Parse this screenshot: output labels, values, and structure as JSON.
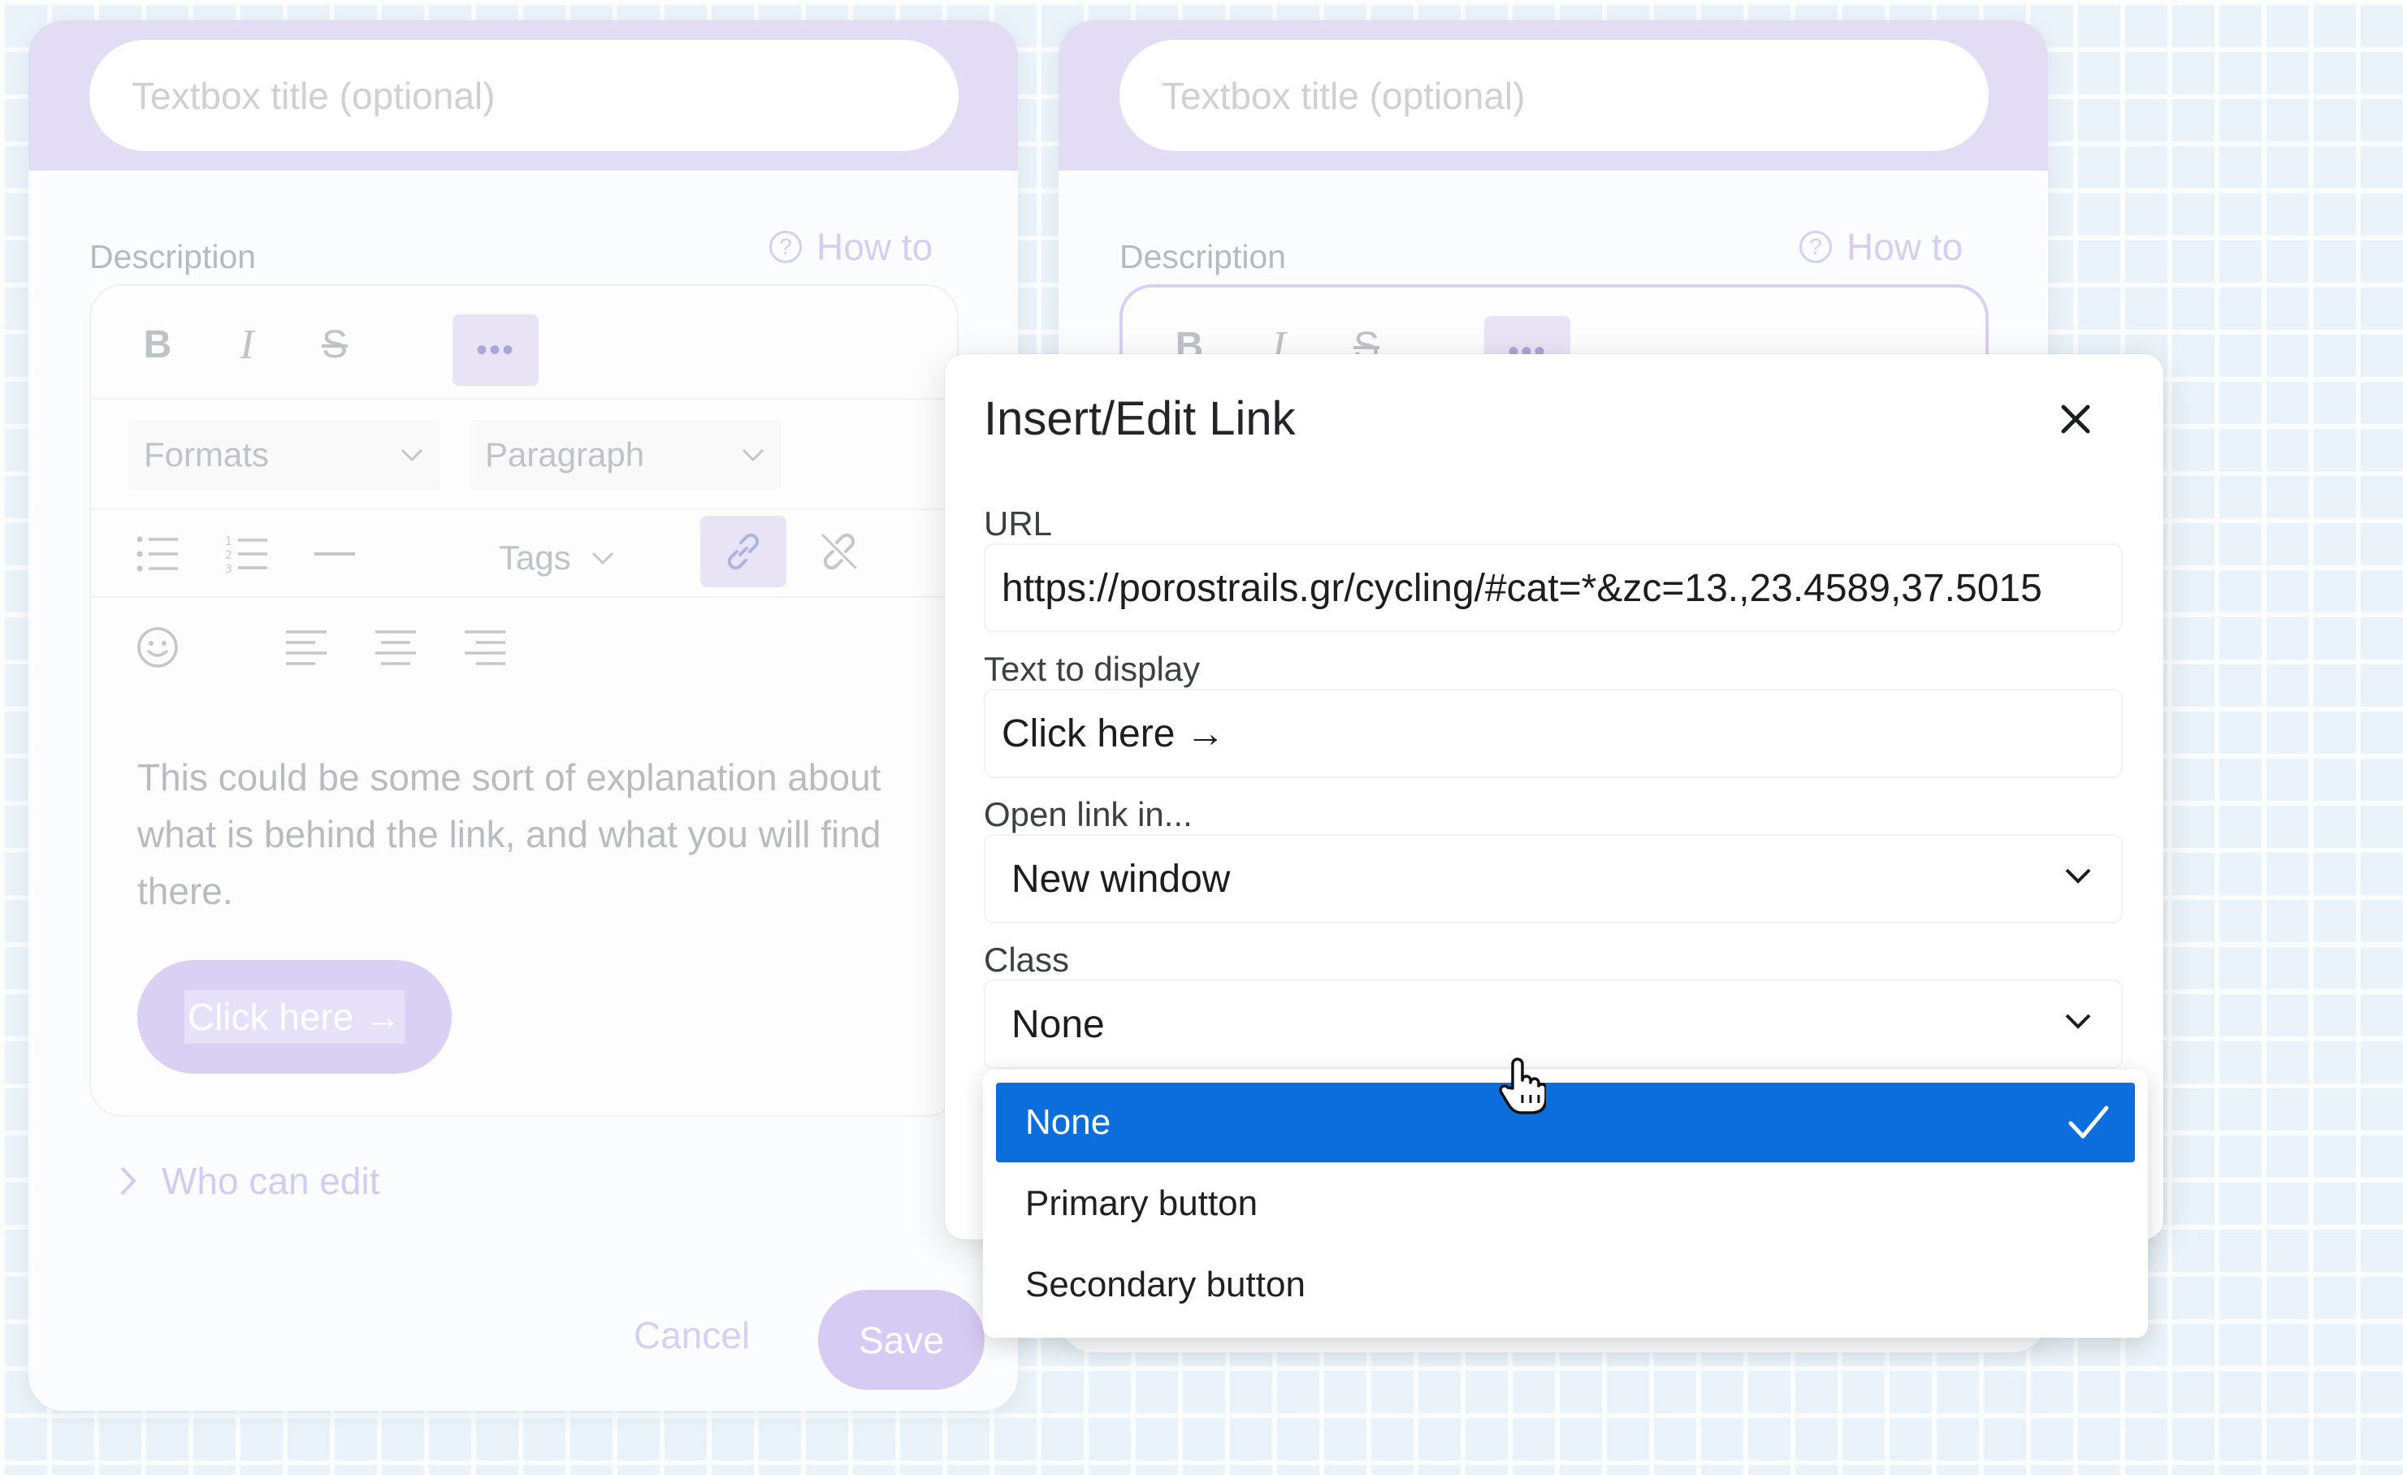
{
  "left_card": {
    "title_placeholder": "Textbox title (optional)",
    "description_label": "Description",
    "how_to": "How to",
    "toolbar": {
      "formats": "Formats",
      "paragraph": "Paragraph",
      "tags": "Tags"
    },
    "body_text": "This could be some sort of explanation about what is behind the link, and what you will find there.",
    "link_button": "Click here →",
    "who_can_edit": "Who can edit",
    "cancel": "Cancel",
    "save": "Save"
  },
  "right_card": {
    "title_placeholder": "Textbox title (optional)",
    "description_label": "Description",
    "how_to": "How to"
  },
  "modal": {
    "title": "Insert/Edit Link",
    "url_label": "URL",
    "url_value": "https://porostrails.gr/cycling/#cat=*&zc=13.,23.4589,37.5015",
    "text_label": "Text to display",
    "text_value": "Click here →",
    "open_label": "Open link in...",
    "open_value": "New window",
    "class_label": "Class",
    "class_value": "None"
  },
  "dropdown": {
    "options": [
      "None",
      "Primary button",
      "Secondary button"
    ],
    "selected": "None"
  },
  "colors": {
    "accent": "#0c6ddd",
    "card_header": "#e2dcf4",
    "background": "#eaf3f9"
  }
}
